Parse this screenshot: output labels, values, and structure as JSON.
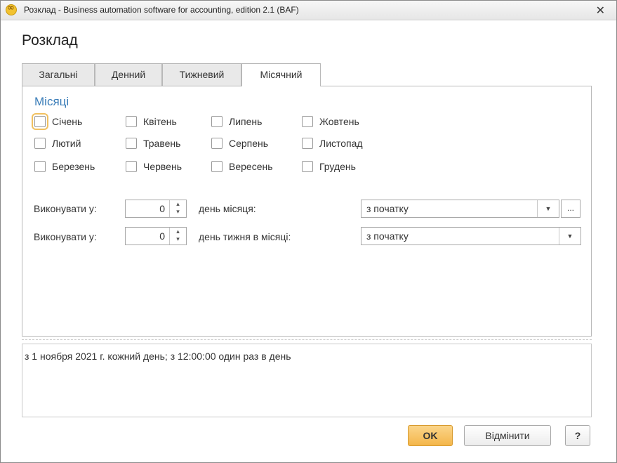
{
  "window": {
    "title": "Розклад - Business automation software for accounting, edition 2.1  (BAF)",
    "close_glyph": "✕",
    "icon": "app-logo-icon"
  },
  "page_title": "Розклад",
  "tabs": [
    {
      "label": "Загальні",
      "active": false
    },
    {
      "label": "Денний",
      "active": false
    },
    {
      "label": "Тижневий",
      "active": false
    },
    {
      "label": "Місячний",
      "active": true
    }
  ],
  "months_section": {
    "title": "Місяці",
    "months": [
      {
        "label": "Січень",
        "checked": false
      },
      {
        "label": "Лютий",
        "checked": false
      },
      {
        "label": "Березень",
        "checked": false
      },
      {
        "label": "Квітень",
        "checked": false
      },
      {
        "label": "Травень",
        "checked": false
      },
      {
        "label": "Червень",
        "checked": false
      },
      {
        "label": "Липень",
        "checked": false
      },
      {
        "label": "Серпень",
        "checked": false
      },
      {
        "label": "Вересень",
        "checked": false
      },
      {
        "label": "Жовтень",
        "checked": false
      },
      {
        "label": "Листопад",
        "checked": false
      },
      {
        "label": "Грудень",
        "checked": false
      }
    ]
  },
  "run_day_of_month": {
    "label": "Виконувати у:",
    "value": "0",
    "suffix": "день місяця:",
    "mode": "з початку",
    "ellipsis": "..."
  },
  "run_day_of_week": {
    "label": "Виконувати у:",
    "value": "0",
    "suffix": "день тижня в місяці:",
    "mode": "з початку"
  },
  "description": "з 1 ноября 2021 г. кожний день; з 12:00:00 один раз в день",
  "buttons": {
    "ok": "OK",
    "cancel": "Відмінити",
    "help": "?"
  },
  "colors": {
    "section_title": "#3a7db8",
    "ok_button": "#f4b64a",
    "focus_outline": "#f0c060"
  }
}
